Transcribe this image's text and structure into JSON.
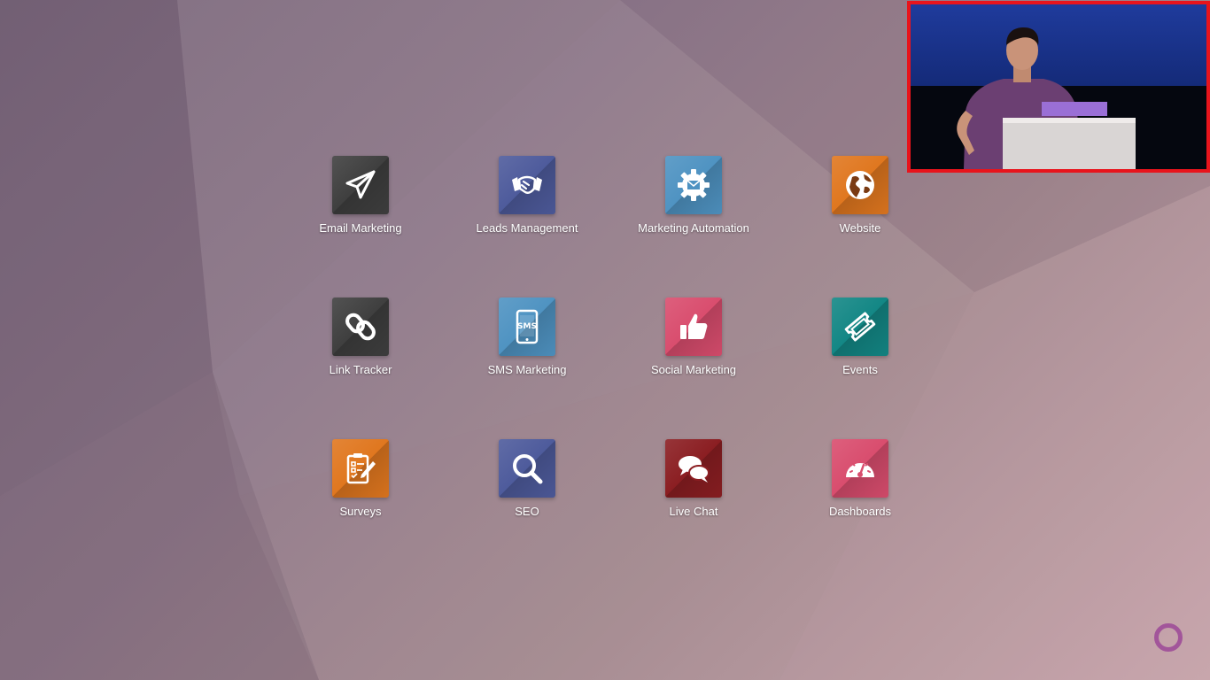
{
  "apps": [
    {
      "label": "Email Marketing",
      "icon": "paper-plane-icon",
      "color": "#3f3f3f"
    },
    {
      "label": "Leads Management",
      "icon": "handshake-icon",
      "color": "#4e5b9c"
    },
    {
      "label": "Marketing Automation",
      "icon": "gear-envelope-icon",
      "color": "#4f93c2"
    },
    {
      "label": "Website",
      "icon": "globe-icon",
      "color": "#e0771f"
    },
    {
      "label": "Link Tracker",
      "icon": "chain-link-icon",
      "color": "#3f3f3f"
    },
    {
      "label": "SMS Marketing",
      "icon": "phone-sms-icon",
      "color": "#4f93c2",
      "icon_text": "SMS"
    },
    {
      "label": "Social Marketing",
      "icon": "thumbs-up-icon",
      "color": "#d94d6e"
    },
    {
      "label": "Events",
      "icon": "ticket-icon",
      "color": "#138785"
    },
    {
      "label": "Surveys",
      "icon": "clipboard-pencil-icon",
      "color": "#e0771f"
    },
    {
      "label": "SEO",
      "icon": "magnifier-icon",
      "color": "#4e5b9c"
    },
    {
      "label": "Live Chat",
      "icon": "chat-bubbles-icon",
      "color": "#8b1e22"
    },
    {
      "label": "Dashboards",
      "icon": "speedometer-icon",
      "color": "#d94d6e"
    }
  ],
  "webcam": {
    "border_color": "#e8141c"
  },
  "logo": {
    "icon": "brand-ring-icon",
    "color": "#a2559a"
  }
}
